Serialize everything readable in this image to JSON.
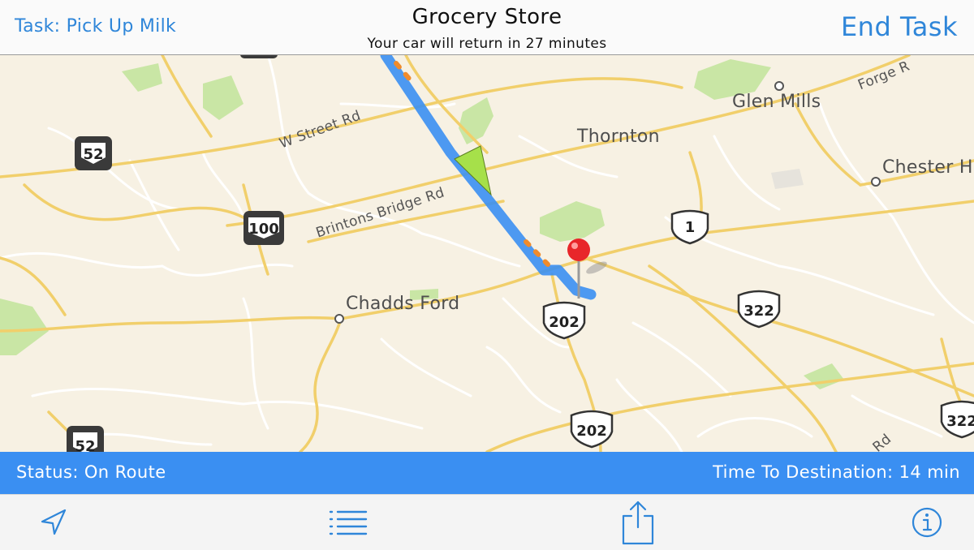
{
  "header": {
    "task_label": "Task: Pick Up Milk",
    "title": "Grocery Store",
    "subtitle": "Your car will return in 27 minutes",
    "end_task_label": "End Task"
  },
  "map": {
    "places": {
      "thornton": "Thornton",
      "glen_mills": "Glen Mills",
      "chester_heights": "Chester H",
      "chadds_ford": "Chadds Ford"
    },
    "roads": {
      "w_street": "W Street Rd",
      "brintons_bridge": "Brintons Bridge Rd",
      "forge": "Forge R",
      "rd_bottom_right": "Rd"
    },
    "shields": {
      "pa52_top": "52",
      "pa52_bottom": "52",
      "pa100": "100",
      "us1": "1",
      "us202_a": "202",
      "us202_b": "202",
      "us322_a": "322",
      "us322_b": "322"
    },
    "route_color": "#3a8ff2",
    "marker_color": "#e8262a",
    "vehicle_color": "#a6e04a"
  },
  "status": {
    "left": "Status: On Route",
    "right": "Time To Destination: 14 min"
  },
  "toolbar": {
    "icons": [
      "location-arrow-icon",
      "list-icon",
      "share-icon",
      "info-icon"
    ]
  }
}
